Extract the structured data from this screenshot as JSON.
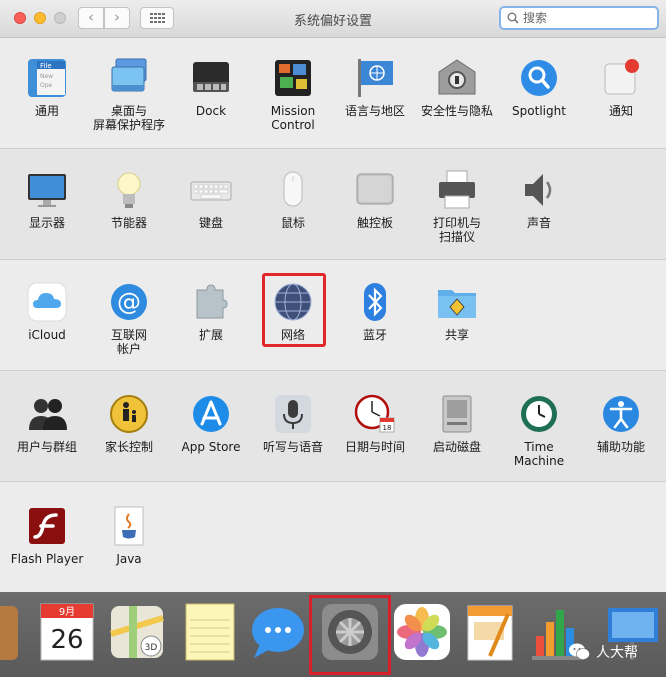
{
  "window": {
    "title": "系统偏好设置",
    "search_placeholder": "搜索"
  },
  "rows": [
    {
      "items": [
        {
          "label": "通用",
          "icon": "general-icon"
        },
        {
          "label": "桌面与\n屏幕保护程序",
          "icon": "desktop-screensaver-icon"
        },
        {
          "label": "Dock",
          "icon": "dock-icon"
        },
        {
          "label": "Mission\nControl",
          "icon": "mission-control-icon"
        },
        {
          "label": "语言与地区",
          "icon": "language-region-icon"
        },
        {
          "label": "安全性与隐私",
          "icon": "security-privacy-icon"
        },
        {
          "label": "Spotlight",
          "icon": "spotlight-icon"
        },
        {
          "label": "通知",
          "icon": "notifications-icon"
        }
      ]
    },
    {
      "items": [
        {
          "label": "显示器",
          "icon": "displays-icon"
        },
        {
          "label": "节能器",
          "icon": "energy-saver-icon"
        },
        {
          "label": "键盘",
          "icon": "keyboard-icon"
        },
        {
          "label": "鼠标",
          "icon": "mouse-icon"
        },
        {
          "label": "触控板",
          "icon": "trackpad-icon"
        },
        {
          "label": "打印机与\n扫描仪",
          "icon": "printers-scanners-icon"
        },
        {
          "label": "声音",
          "icon": "sound-icon"
        }
      ]
    },
    {
      "items": [
        {
          "label": "iCloud",
          "icon": "icloud-icon"
        },
        {
          "label": "互联网\n帐户",
          "icon": "internet-accounts-icon"
        },
        {
          "label": "扩展",
          "icon": "extensions-icon"
        },
        {
          "label": "网络",
          "icon": "network-icon"
        },
        {
          "label": "蓝牙",
          "icon": "bluetooth-icon"
        },
        {
          "label": "共享",
          "icon": "sharing-icon"
        }
      ]
    },
    {
      "items": [
        {
          "label": "用户与群组",
          "icon": "users-groups-icon"
        },
        {
          "label": "家长控制",
          "icon": "parental-controls-icon"
        },
        {
          "label": "App Store",
          "icon": "app-store-icon"
        },
        {
          "label": "听写与语音",
          "icon": "dictation-speech-icon"
        },
        {
          "label": "日期与时间",
          "icon": "date-time-icon"
        },
        {
          "label": "启动磁盘",
          "icon": "startup-disk-icon"
        },
        {
          "label": "Time Machine",
          "icon": "time-machine-icon"
        },
        {
          "label": "辅助功能",
          "icon": "accessibility-icon"
        }
      ]
    },
    {
      "items": [
        {
          "label": "Flash Player",
          "icon": "flash-player-icon"
        },
        {
          "label": "Java",
          "icon": "java-icon"
        }
      ]
    }
  ],
  "icon_text": {
    "general": "File",
    "general_lines": [
      "New",
      "Ope"
    ],
    "calendar_month": "9月",
    "calendar_day": "26",
    "date_day": "18",
    "maps_badge": "3D"
  },
  "dock": {
    "items": [
      {
        "name": "finder-partial-icon"
      },
      {
        "name": "calendar-icon"
      },
      {
        "name": "maps-icon"
      },
      {
        "name": "notes-icon"
      },
      {
        "name": "messages-icon"
      },
      {
        "name": "system-preferences-icon"
      },
      {
        "name": "photos-icon"
      },
      {
        "name": "pages-icon"
      },
      {
        "name": "numbers-icon"
      },
      {
        "name": "keynote-icon"
      }
    ]
  },
  "watermark": {
    "text": "人大帮"
  },
  "highlight_color": "#e0282a"
}
